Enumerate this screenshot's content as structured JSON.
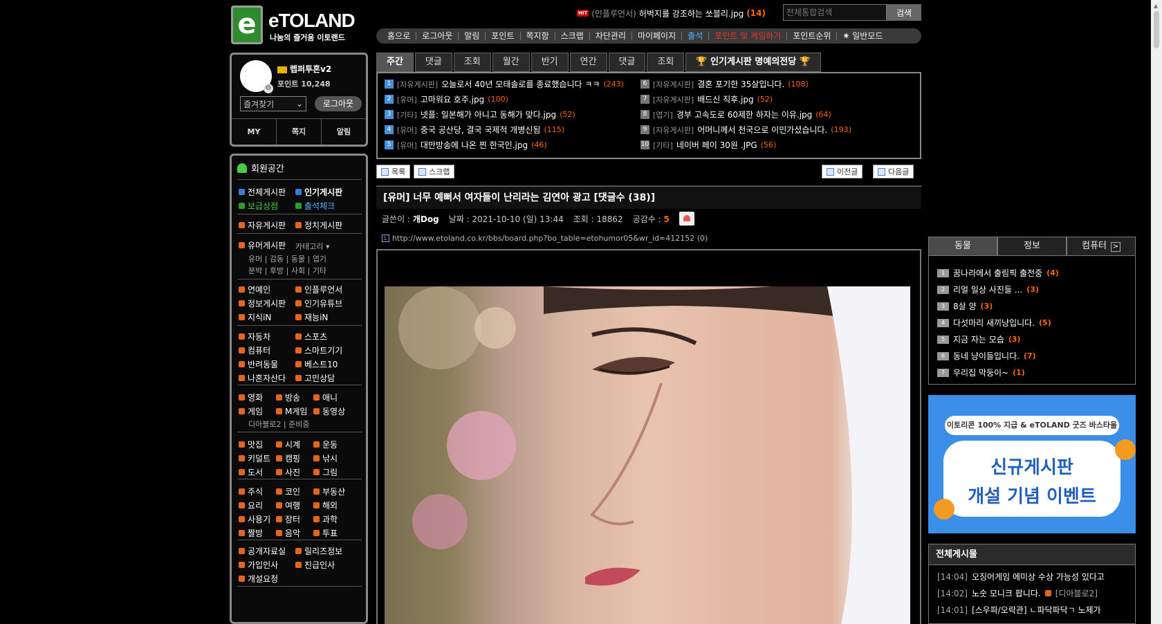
{
  "logo": {
    "letter": "e",
    "title": "eTOLAND",
    "subtitle": "나눔의 즐거움 이토랜드"
  },
  "hit": {
    "badge": "HIT",
    "category": "(인플루언서)",
    "title": "허벅지를 강조하는 쏘블리.jpg",
    "count": "(14)"
  },
  "search": {
    "placeholder": "전체통합검색",
    "button": "검색"
  },
  "topnav": [
    "홈으로",
    "로그아웃",
    "알림",
    "포인트",
    "쪽지함",
    "스크랩",
    "차단관리",
    "마이페이지",
    "출석",
    "포인트 및 게임하기",
    "포인트순위",
    "✷ 일반모드"
  ],
  "profile": {
    "nickname": "렙퍼투혼v2",
    "points": "포인트 10,248",
    "favorites": "즐겨찾기",
    "logout": "로그아웃",
    "tabs": [
      "MY",
      "쪽지",
      "알림"
    ]
  },
  "menu": {
    "title": "회원공간",
    "top": [
      {
        "label": "전체게시판",
        "color": "b"
      },
      {
        "label": "인기게시판",
        "color": "b"
      },
      {
        "label": "보급상점",
        "color": "g"
      },
      {
        "label": "출석체크",
        "color": "g"
      }
    ],
    "groupA": [
      "자유게시판",
      "정치게시판"
    ],
    "humor": {
      "label": "유머게시판",
      "category": "카테고리 ▾",
      "sub1": "유머 | 감동 | 동물 | 엽기",
      "sub2": "분박 | 후방 | 사회 | 기타"
    },
    "groupB": [
      "연예인",
      "인플루언서",
      "정보게시판",
      "인기유튜브",
      "지식iN",
      "재능iN"
    ],
    "groupC": [
      "자동차",
      "스포츠",
      "컴퓨터",
      "스마트기기",
      "반려동물",
      "베스트10",
      "나혼자산다",
      "고민상담"
    ],
    "groupD": [
      "영화",
      "방송",
      "애니",
      "게임",
      "M게임",
      "동영상"
    ],
    "groupD_sub": "디아블로2 | 준비중",
    "groupE": [
      "맛집",
      "시계",
      "운동",
      "키덜트",
      "캠핑",
      "낚시",
      "도서",
      "사진",
      "그림"
    ],
    "groupF": [
      "주식",
      "코인",
      "부동산",
      "요리",
      "여행",
      "해외",
      "사용기",
      "장터",
      "과학",
      "짤방",
      "음악",
      "투표"
    ],
    "groupG": [
      "공개자료실",
      "릴리즈정보",
      "가입인사",
      "진급인사",
      "개설요청"
    ]
  },
  "rank_tabs": [
    "주간",
    "댓글",
    "조회",
    "월간",
    "반기",
    "연간",
    "댓글",
    "조회",
    "인기게시판 명예의전당"
  ],
  "ranking": [
    {
      "n": "1",
      "cat": "[자유게시판]",
      "title": "오늘로서 40년 모태솔로를 종료했습니다 ㅋㅋ",
      "cnt": "(243)"
    },
    {
      "n": "2",
      "cat": "[유머]",
      "title": "고마워요 호주.jpg",
      "cnt": "(100)"
    },
    {
      "n": "3",
      "cat": "[기타]",
      "title": "넷플: 일본해가 아니고 동해가 맞다.jpg",
      "cnt": "(52)"
    },
    {
      "n": "4",
      "cat": "[유머]",
      "title": "중국 공산당, 결국 국제적 개병신됨",
      "cnt": "(115)"
    },
    {
      "n": "5",
      "cat": "[유머]",
      "title": "대만방송에 나온 찐 한국인.jpg",
      "cnt": "(46)"
    },
    {
      "n": "6",
      "cat": "[자유게시판]",
      "title": "결혼 포기한 35살입니다.",
      "cnt": "(108)"
    },
    {
      "n": "7",
      "cat": "[자유게시판]",
      "title": "배드신 직후.jpg",
      "cnt": "(52)"
    },
    {
      "n": "8",
      "cat": "[엽기]",
      "title": "경부 고속도로 60제한 하자는 이유.jpg",
      "cnt": "(64)"
    },
    {
      "n": "9",
      "cat": "[자유게시판]",
      "title": "어머니께서 천국으로 이민가셨습니다.",
      "cnt": "(193)"
    },
    {
      "n": "10",
      "cat": "[기타]",
      "title": "네이버 페이 30원 .JPG",
      "cnt": "(56)"
    }
  ],
  "buttons": {
    "list": "목록",
    "scrap": "스크랩",
    "prev": "이전글",
    "next": "다음글"
  },
  "post": {
    "title": "[유머] 너무 예뻐서 여자들이 난리라는 김연아 광고 [댓글수 (38)]",
    "author_label": "글쓴이 :",
    "author": "개Dog",
    "date": "날짜 : 2021-10-10 (일) 13:44",
    "views": "조회 : 18862",
    "likes_label": "공감수 :",
    "likes": "5",
    "url": "http://www.etoland.co.kr/bbs/board.php?bo_table=etohumor05&wr_id=412152 (0)"
  },
  "right_tabs": [
    "동물",
    "정보",
    "컴퓨터"
  ],
  "right_list": [
    {
      "n": "1",
      "title": "꿈나라에서 출림픽 출전중",
      "cnt": "(4)"
    },
    {
      "n": "2",
      "title": "리얼 일상 사진들 ...",
      "cnt": "(3)"
    },
    {
      "n": "3",
      "title": "8살 양",
      "cnt": "(3)"
    },
    {
      "n": "4",
      "title": "다섯마리 새끼냥입니다.",
      "cnt": "(5)"
    },
    {
      "n": "5",
      "title": "지금 자는 모습",
      "cnt": "(3)"
    },
    {
      "n": "6",
      "title": "동네 냥이들입니다.",
      "cnt": "(7)"
    },
    {
      "n": "7",
      "title": "우리집 막둥이~",
      "cnt": "(1)"
    }
  ],
  "banner": {
    "top": "이토리콘 100% 지급 & eTOLAND 굿즈 바스타올",
    "line1": "신규게시판",
    "line2": "개설 기념 이벤트"
  },
  "all_posts": {
    "title": "전체게시물",
    "items": [
      {
        "time": "[14:04]",
        "title": "오징어게임 에미상 수상 가능성 있다고",
        "cat": ""
      },
      {
        "time": "[14:02]",
        "title": "노숫 모니크 팝니다.",
        "cat": "[디아블로2]"
      },
      {
        "time": "[14:01]",
        "title": "[스우파/오락관] ㄴ파닥파닥ㄱ 노제가",
        "cat": ""
      }
    ]
  }
}
